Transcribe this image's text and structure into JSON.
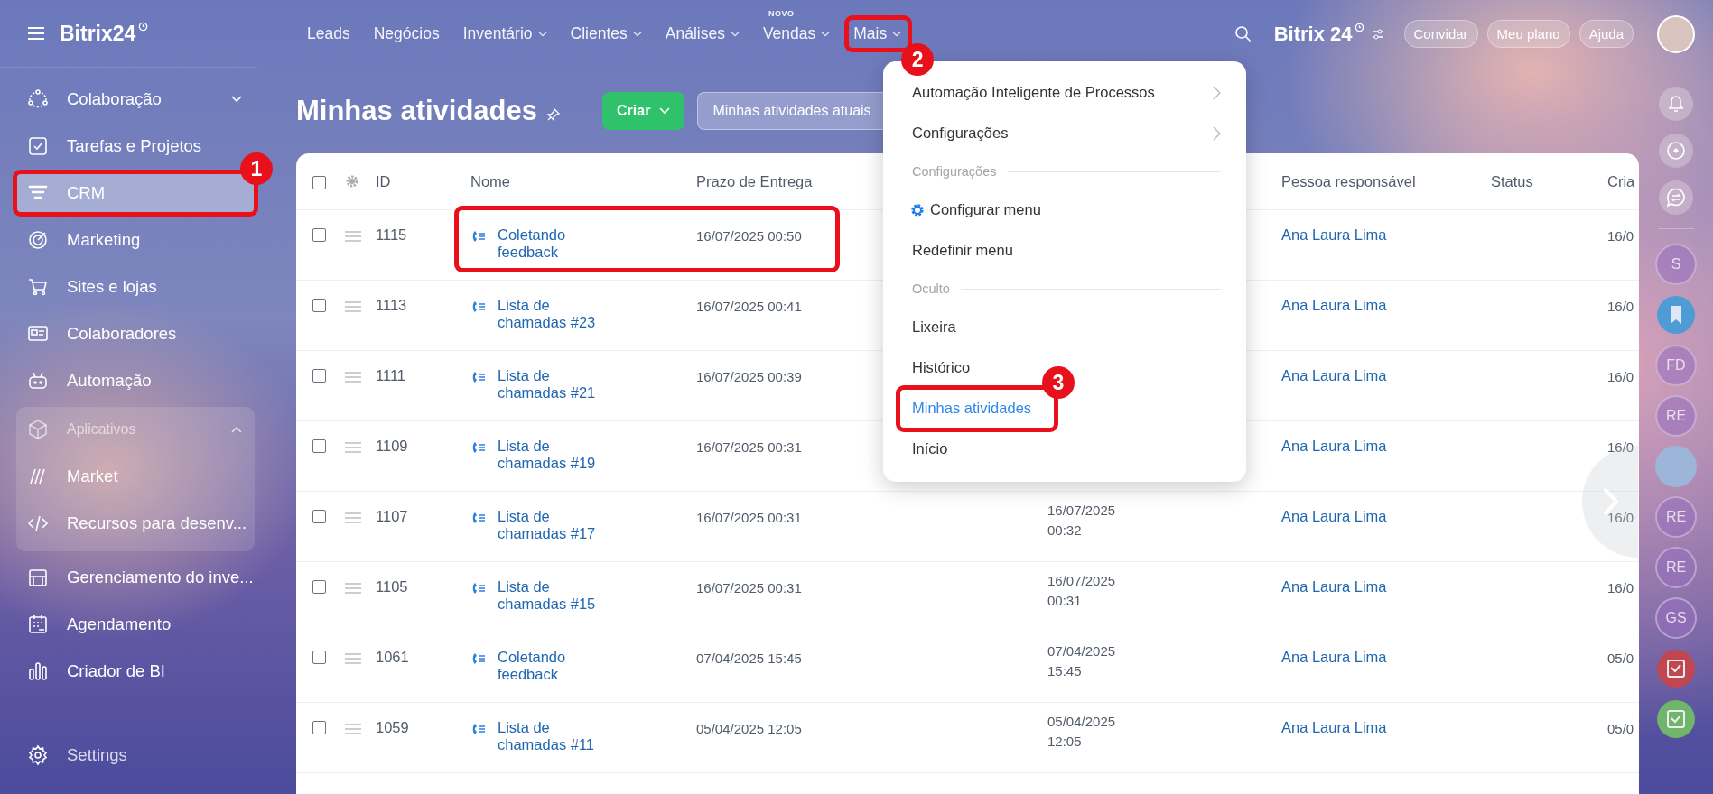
{
  "topbar": {
    "logo": "Bitrix24",
    "nav": [
      {
        "label": "Leads",
        "dropdown": false
      },
      {
        "label": "Negócios",
        "dropdown": false
      },
      {
        "label": "Inventário",
        "dropdown": true
      },
      {
        "label": "Clientes",
        "dropdown": true
      },
      {
        "label": "Análises",
        "dropdown": true
      },
      {
        "label": "Vendas",
        "dropdown": true,
        "badge": "NOVO"
      },
      {
        "label": "Mais",
        "dropdown": true,
        "annotation": "2"
      }
    ],
    "brand": "Bitrix 24",
    "buttons": [
      "Convidar",
      "Meu plano",
      "Ajuda"
    ]
  },
  "sidebar": {
    "items": [
      {
        "kind": "item",
        "label": "Colaboração",
        "selected": false,
        "expanded": false
      },
      {
        "kind": "item",
        "label": "Tarefas e Projetos",
        "selected": false
      },
      {
        "kind": "item",
        "label": "CRM",
        "selected": true,
        "annotation": "1"
      },
      {
        "kind": "item",
        "label": "Marketing",
        "selected": false
      },
      {
        "kind": "item",
        "label": "Sites e lojas",
        "selected": false
      },
      {
        "kind": "item",
        "label": "Colaboradores",
        "selected": false
      },
      {
        "kind": "item",
        "label": "Automação",
        "selected": false
      },
      {
        "kind": "group",
        "label": "Aplicativos",
        "expanded": true,
        "children": [
          {
            "label": "Market",
            "selected": false
          },
          {
            "label": "Recursos para desenv...",
            "selected": false
          }
        ]
      },
      {
        "kind": "item",
        "label": "Gerenciamento do inve...",
        "selected": false
      },
      {
        "kind": "item",
        "label": "Agendamento",
        "selected": false
      },
      {
        "kind": "item",
        "label": "Criador de BI",
        "selected": false
      }
    ],
    "footer": "Settings"
  },
  "page": {
    "title": "Minhas atividades",
    "create_button": "Criar",
    "filter": "Minhas atividades atuais"
  },
  "table": {
    "select_all_checked": false,
    "columns": {
      "id": "ID",
      "name": "Nome",
      "deadline": "Prazo de Entrega",
      "responsible": "Pessoa responsável",
      "status": "Status",
      "column_8": "Cria"
    },
    "rows": [
      {
        "id": "1115",
        "name": "Coletando feedback",
        "deadline": "16/07/2025 00:50",
        "responsible": "Ana Laura Lima",
        "column_8": "16/0",
        "checked": false,
        "annotated": true
      },
      {
        "id": "1113",
        "name": "Lista de chamadas #23",
        "deadline": "16/07/2025 00:41",
        "responsible": "Ana Laura Lima",
        "column_8": "16/0",
        "checked": false,
        "annotated": false
      },
      {
        "id": "1111",
        "name": "Lista de chamadas #21",
        "deadline": "16/07/2025 00:39",
        "responsible": "Ana Laura Lima",
        "column_8": "16/0",
        "checked": false,
        "annotated": false
      },
      {
        "id": "1109",
        "name": "Lista de chamadas #19",
        "deadline": "16/07/2025 00:31",
        "responsible": "Ana Laura Lima",
        "column_8": "16/0",
        "checked": false,
        "annotated": false
      },
      {
        "id": "1107",
        "name": "Lista de chamadas #17",
        "deadline": "16/07/2025 00:31",
        "column_5": "16/07/2025 00:32",
        "responsible": "Ana Laura Lima",
        "column_8": "16/0",
        "checked": false,
        "annotated": false
      },
      {
        "id": "1105",
        "name": "Lista de chamadas #15",
        "deadline": "16/07/2025 00:31",
        "column_5": "16/07/2025 00:31",
        "responsible": "Ana Laura Lima",
        "column_8": "16/0",
        "checked": false,
        "annotated": false
      },
      {
        "id": "1061",
        "name": "Coletando feedback",
        "deadline": "07/04/2025 15:45",
        "column_5": "07/04/2025 15:45",
        "responsible": "Ana Laura Lima",
        "column_8": "05/0",
        "checked": false,
        "annotated": false
      },
      {
        "id": "1059",
        "name": "Lista de chamadas #11",
        "deadline": "05/04/2025 12:05",
        "column_5": "05/04/2025 12:05",
        "responsible": "Ana Laura Lima",
        "column_8": "05/0",
        "checked": false,
        "annotated": false
      }
    ]
  },
  "more_menu": {
    "items": [
      {
        "kind": "submenu",
        "label": "Automação Inteligente de Processos"
      },
      {
        "kind": "submenu",
        "label": "Configurações"
      },
      {
        "kind": "section",
        "label": "Configurações"
      },
      {
        "kind": "setting",
        "label": "Configurar menu"
      },
      {
        "kind": "item",
        "label": "Redefinir menu",
        "selected": false
      },
      {
        "kind": "section",
        "label": "Oculto"
      },
      {
        "kind": "item",
        "label": "Lixeira",
        "selected": false
      },
      {
        "kind": "item",
        "label": "Histórico",
        "selected": false
      },
      {
        "kind": "item",
        "label": "Minhas atividades",
        "selected": true,
        "annotation": "3"
      },
      {
        "kind": "item",
        "label": "Início",
        "selected": false
      }
    ]
  },
  "rail": {
    "items": [
      {
        "kind": "initials",
        "text": "S"
      },
      {
        "kind": "bookmark"
      },
      {
        "kind": "initials",
        "text": "FD"
      },
      {
        "kind": "initials",
        "text": "RE"
      },
      {
        "kind": "photo"
      },
      {
        "kind": "initials",
        "text": "RE"
      },
      {
        "kind": "initials",
        "text": "RE"
      },
      {
        "kind": "initials",
        "text": "GS"
      },
      {
        "kind": "task",
        "color": "#c0474f"
      },
      {
        "kind": "task",
        "color": "#6fb56a"
      }
    ]
  }
}
